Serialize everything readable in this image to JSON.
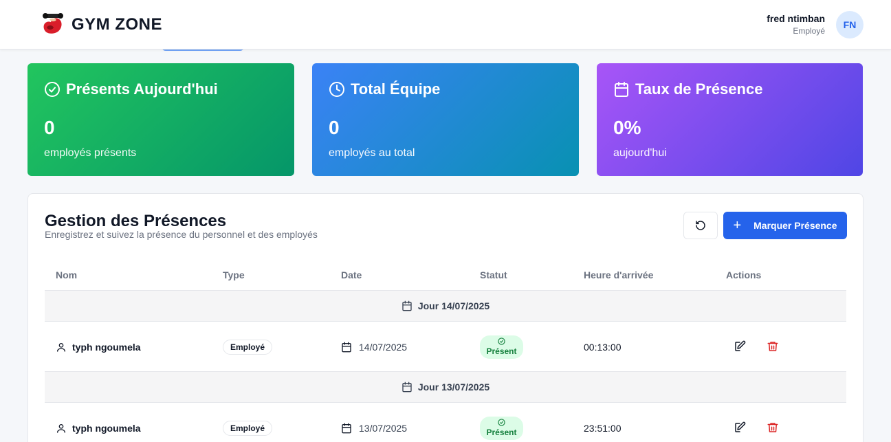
{
  "header": {
    "brand": "GYM ZONE",
    "user_name": "fred ntimban",
    "user_role": "Employé",
    "avatar_initials": "FN"
  },
  "stats": [
    {
      "title": "Présents Aujourd'hui",
      "value": "0",
      "subtitle": "employés présents",
      "icon": "check-circle-icon",
      "color_from": "#22c55e",
      "color_to": "#059669"
    },
    {
      "title": "Total Équipe",
      "value": "0",
      "subtitle": "employés au total",
      "icon": "clock-icon",
      "color_from": "#3b82f6",
      "color_to": "#0891b2"
    },
    {
      "title": "Taux de Présence",
      "value": "0%",
      "subtitle": "aujourd'hui",
      "icon": "calendar-icon",
      "color_from": "#a855f7",
      "color_to": "#4f46e5"
    }
  ],
  "panel": {
    "title": "Gestion des Présences",
    "description": "Enregistrez et suivez la présence du personnel et des employés",
    "refresh_icon": "refresh-icon",
    "primary_label": "Marquer Présence",
    "primary_icon": "plus-icon",
    "accent": "#2563eb"
  },
  "table": {
    "columns": [
      "Nom",
      "Type",
      "Date",
      "Statut",
      "Heure d'arrivée",
      "Actions"
    ],
    "groups": [
      {
        "label": "Jour 14/07/2025",
        "rows": [
          {
            "name": "typh ngoumela",
            "type": "Employé",
            "date": "14/07/2025",
            "status": "Présent",
            "arrival": "00:13:00"
          }
        ]
      },
      {
        "label": "Jour 13/07/2025",
        "rows": [
          {
            "name": "typh ngoumela",
            "type": "Employé",
            "date": "13/07/2025",
            "status": "Présent",
            "arrival": "23:51:00"
          }
        ]
      }
    ]
  }
}
